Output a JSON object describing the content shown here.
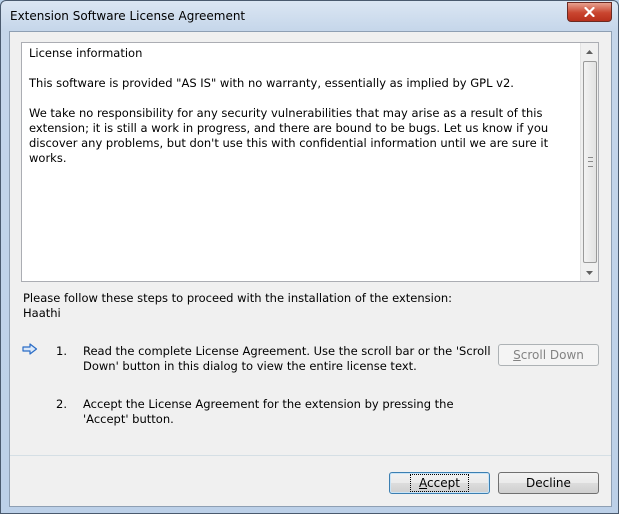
{
  "window": {
    "title": "Extension Software License Agreement"
  },
  "license": {
    "heading": "License information",
    "paragraphs": [
      "This software is provided \"AS IS\" with no warranty, essentially as implied by GPL v2.",
      "We take no responsibility for any security vulnerabilities that may arise as a result of this extension; it is still a work in progress, and there are bound to be bugs. Let us know if you discover any problems, but don't use this with confidential information until we are sure it works."
    ]
  },
  "instructions": {
    "intro": "Please follow these steps to proceed with the installation of the extension:",
    "extension_name": "Haathi"
  },
  "steps": [
    {
      "number": "1.",
      "text": "Read the complete License Agreement. Use the scroll bar or the 'Scroll Down' button in this dialog to view the entire license text."
    },
    {
      "number": "2.",
      "text": "Accept the License Agreement for the extension by pressing the 'Accept' button."
    }
  ],
  "buttons": {
    "scroll_down": {
      "prefix": "S",
      "rest": "croll Down",
      "enabled": false
    },
    "accept": {
      "prefix": "A",
      "rest": "ccept"
    },
    "decline": {
      "label": "Decline"
    }
  },
  "icons": {
    "close": "close-icon",
    "step_arrow": "arrow-right-icon",
    "scroll_up": "arrow-up-icon",
    "scroll_down": "arrow-down-icon"
  },
  "colors": {
    "close_button": "#c9452f",
    "step_arrow": "#2a6cc6",
    "default_button_border": "#3c7fb1"
  }
}
